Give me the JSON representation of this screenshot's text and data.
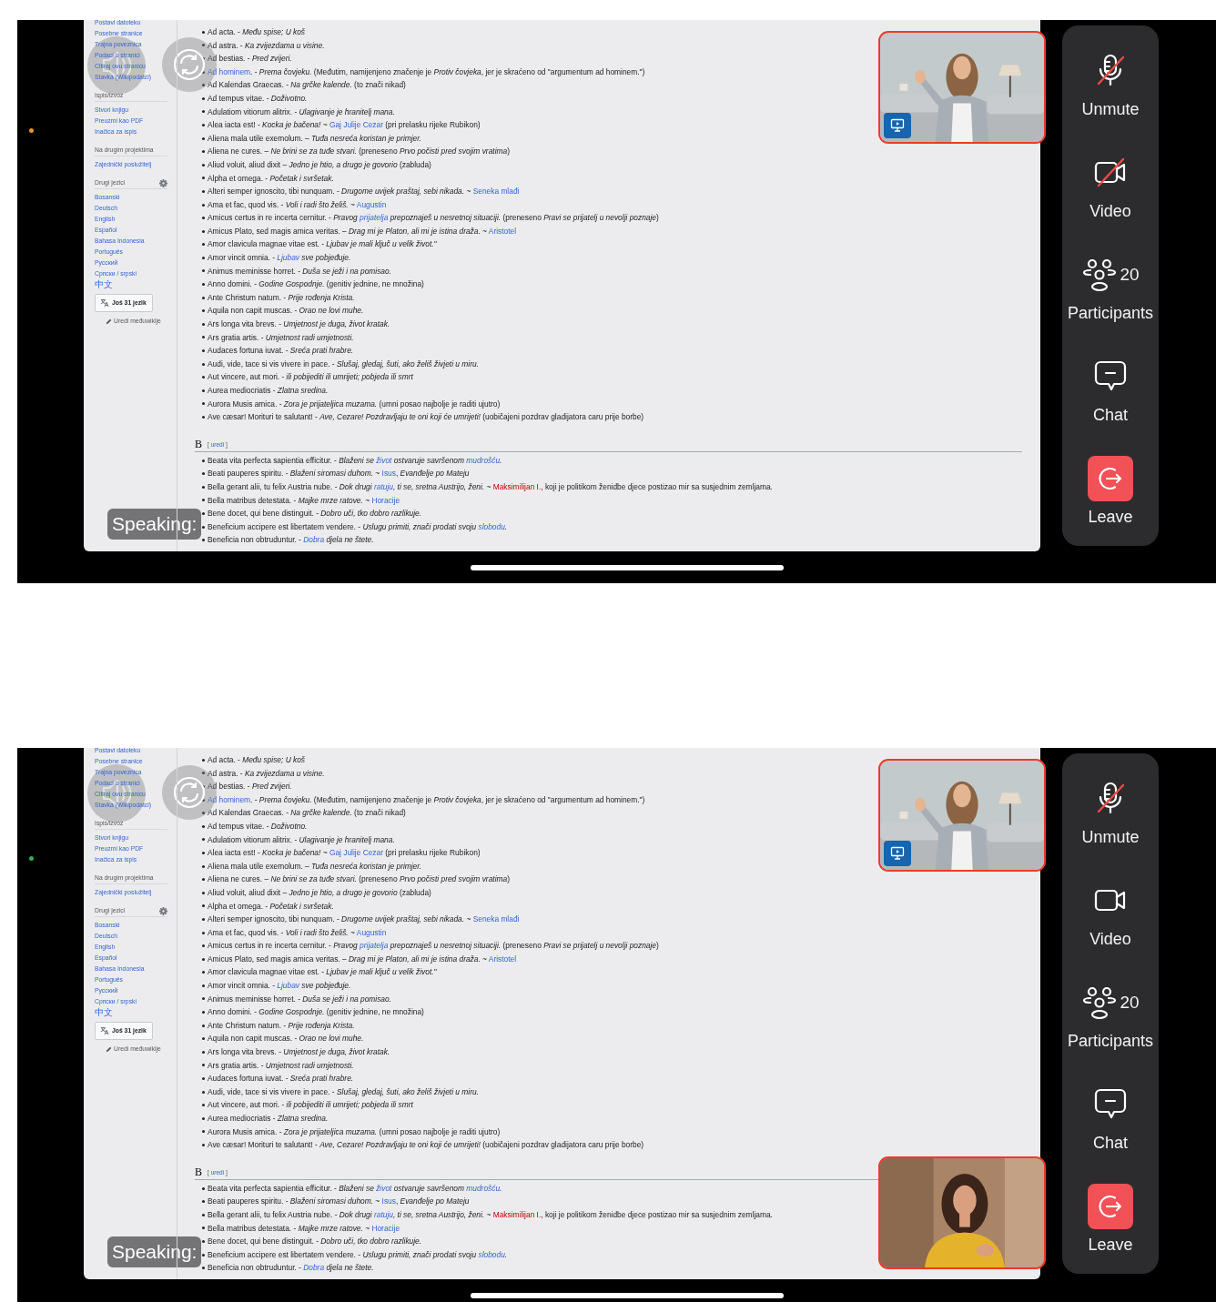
{
  "screens": [
    {
      "status_dot": {
        "color": "#f0901e"
      },
      "shared_page": {
        "sidebar": {
          "groups": [
            {
              "settings_icon": false,
              "links": [
                "Postavi datoteku",
                "Posebne stranice",
                "Trajna poveznica",
                "Podaci o stranici",
                "Citiraj ovu stranicu",
                "Stavka (Wikipodatci)"
              ]
            },
            {
              "heading": "Ispis/izvoz",
              "settings_icon": false,
              "links": [
                "Stvori knjigu",
                "Preuzmi kao PDF",
                "Inačica za ispis"
              ]
            },
            {
              "heading": "Na drugim projektima",
              "settings_icon": false,
              "links": [
                "Zajednički poslužitelj"
              ]
            },
            {
              "heading": "Drugi jezici",
              "settings_icon": true,
              "links": [
                "Bosanski",
                "Deutsch",
                "English",
                "Español",
                "Bahasa Indonesia",
                "Português",
                "Русский",
                "Српски / srpski",
                "中文"
              ]
            }
          ],
          "more_languages_button": "Još 31 jezik",
          "edit_interlanguage_link": "Uredi međuwikije"
        },
        "entries_a": [
          [
            {
              "text": "Ad acta. - *Među spise; U koš*",
              "kind": "text"
            }
          ],
          [
            {
              "text": "Ad astra. - *Ka zvijezdama u visine.*",
              "kind": "text"
            }
          ],
          [
            {
              "text": "Ad bestias. - *Pred zvijeri.*",
              "kind": "text"
            }
          ],
          [
            {
              "text": "Ad hominem",
              "kind": "link"
            },
            {
              "text": ". - *Prema čovjeku.* (Međutim, namijenjeno značenje je *Protiv čovjeka*, jer je skraćeno od \"argumentum ad hominem.\")",
              "kind": "text"
            }
          ],
          [
            {
              "text": "Ad Kalendas Graecas. - *Na grčke kalende.* (to znači nikad)",
              "kind": "text"
            }
          ],
          [
            {
              "text": "Ad tempus vitae. - *Doživotno.*",
              "kind": "text"
            }
          ],
          [
            {
              "text": "Adulatiom vitiorum alitrix. - *Ulagivanje je hranitelj mana.*",
              "kind": "text"
            }
          ],
          [
            {
              "text": "Alea iacta est! - *Kocka je bačena!* ~ ",
              "kind": "text"
            },
            {
              "text": "Gaj Julije Cezar",
              "kind": "link"
            },
            {
              "text": " (pri prelasku rijeke Rubikon)",
              "kind": "text"
            }
          ],
          [
            {
              "text": "Aliena mala utile exemolum. – *Tuđa nesreća koristan je primjer.*",
              "kind": "text"
            }
          ],
          [
            {
              "text": "Aliena ne cures. – *Ne brini se za tuđe stvari.* (preneseno *Prvo počisti pred svojim vratima*)",
              "kind": "text"
            }
          ],
          [
            {
              "text": "Aliud voluit, aliud dixit – *Jedno je htio, a drugo je govorio* (zabluda)",
              "kind": "text"
            }
          ],
          [
            {
              "text": "Alpha et omega. - *Početak i svršetak.*",
              "kind": "text"
            }
          ],
          [
            {
              "text": "Alteri semper ignoscito, tibi nunquam. - *Drugome uvijek praštaj, sebi nikada.* ~ ",
              "kind": "text"
            },
            {
              "text": "Seneka mlađi",
              "kind": "link"
            }
          ],
          [
            {
              "text": "Ama et fac, quod vis. - *Voli i radi što želiš.* ~ ",
              "kind": "text"
            },
            {
              "text": "Augustin",
              "kind": "link"
            }
          ],
          [
            {
              "text": "Amicus certus in re incerta cernitur. - *Pravog* ",
              "kind": "text"
            },
            {
              "text": "prijatelja",
              "kind": "emlink"
            },
            {
              "text": " *prepoznaješ u nesretnoj situaciji.* (preneseno *Pravi se prijatelj u nevolji poznaje*)",
              "kind": "text"
            }
          ],
          [
            {
              "text": "Amicus Plato, sed magis amica veritas. – *Drag mi je Platon, ali mi je istina draža.* ~ ",
              "kind": "text"
            },
            {
              "text": "Aristotel",
              "kind": "link"
            }
          ],
          [
            {
              "text": "Amor clavicula magnae vitae est. - *Ljubav je mali ključ u velik život.\"*",
              "kind": "text"
            }
          ],
          [
            {
              "text": "Amor vincit omnia. - ",
              "kind": "text"
            },
            {
              "text": "Ljubav",
              "kind": "emlink"
            },
            {
              "text": " *sve pobjeđuje.*",
              "kind": "text"
            }
          ],
          [
            {
              "text": "Animus meminisse horret. - *Duša se ježi i na pomisao.*",
              "kind": "text"
            }
          ],
          [
            {
              "text": "Anno domini. - *Godine Gospodnje.* (genitiv jednine, ne množina)",
              "kind": "text"
            }
          ],
          [
            {
              "text": "Ante Christum natum. - *Prije rođenja Krista.*",
              "kind": "text"
            }
          ],
          [
            {
              "text": "Aquila non capit muscas. - *Orao ne lovi muhe.*",
              "kind": "text"
            }
          ],
          [
            {
              "text": "Ars longa vita brevs. - *Umjetnost je duga, život kratak.*",
              "kind": "text"
            }
          ],
          [
            {
              "text": "Ars gratia artis. - *Umjetnost radi umjetnosti.*",
              "kind": "text"
            }
          ],
          [
            {
              "text": "Audaces fortuna iuvat. - *Sreća prati hrabre.*",
              "kind": "text"
            }
          ],
          [
            {
              "text": "Audi, vide, tace si vis vivere in pace. - *Slušaj, gledaj, šuti, ako želiš živjeti u miru.*",
              "kind": "text"
            }
          ],
          [
            {
              "text": "Aut vincere, aut mori. - *ili pobijediti ili umrijeti; pobjeda ili smrt*",
              "kind": "text"
            }
          ],
          [
            {
              "text": "Aurea mediocriatis - *Zlatna sredina.*",
              "kind": "text"
            }
          ],
          [
            {
              "text": "Aurora Musis amica. - *Zora je prijateljica muzama.* (umni posao najbolje je raditi ujutro)",
              "kind": "text"
            }
          ],
          [
            {
              "text": "Ave cæsar! Morituri te salutant! - *Ave, Cezare! Pozdravljaju te oni koji će umrijeti!* (uobičajeni pozdrav gladijatora caru prije borbe)",
              "kind": "text"
            }
          ]
        ],
        "section": {
          "heading": "B",
          "edit_open": "[",
          "edit_link": "uredi",
          "edit_close": "]"
        },
        "entries_b": [
          [
            {
              "text": "Beata vita perfecta sapientia efficitur. - *Blaženi se* ",
              "kind": "text"
            },
            {
              "text": "život",
              "kind": "emlink"
            },
            {
              "text": " *ostvaruje savršenom* ",
              "kind": "text"
            },
            {
              "text": "mudrošću",
              "kind": "emlink"
            },
            {
              "text": "*.*",
              "kind": "text"
            }
          ],
          [
            {
              "text": "Beati pauperes spiritu. - *Blaženi siromasi duhom.* ~ ",
              "kind": "text"
            },
            {
              "text": "Isus",
              "kind": "link"
            },
            {
              "text": ", *Evanđelje po Mateju*",
              "kind": "text"
            }
          ],
          [
            {
              "text": "Bella gerant alii, tu felix Austria nube. - *Dok drugi* ",
              "kind": "text"
            },
            {
              "text": "ratuju",
              "kind": "emlink"
            },
            {
              "text": "*, ti se, sretna Austrijo, ženi.* ~ ",
              "kind": "text"
            },
            {
              "text": "Maksimilijan I.",
              "kind": "redlink"
            },
            {
              "text": ", koji je politikom ženidbe djece postizao mir sa susjednim zemljama.",
              "kind": "text"
            }
          ],
          [
            {
              "text": "Bella matribus detestata. - *Majke mrze ratove.* ~ ",
              "kind": "text"
            },
            {
              "text": "Horacije",
              "kind": "link"
            }
          ],
          [
            {
              "text": "Bene docet, qui bene distinguit. - *Dobro uči, tko dobro razlikuje.*",
              "kind": "text"
            }
          ],
          [
            {
              "text": "Beneficium accipere est libertatem vendere. - *Uslugu primiti, znači prodati svoju* ",
              "kind": "text"
            },
            {
              "text": "slobodu",
              "kind": "emlink"
            },
            {
              "text": "*.*",
              "kind": "text"
            }
          ],
          [
            {
              "text": "Beneficia non obtruduntur. - ",
              "kind": "text"
            },
            {
              "text": "Dobra",
              "kind": "emlink"
            },
            {
              "text": " *djela ne štete.*",
              "kind": "text"
            }
          ]
        ]
      },
      "speaking_label": "Speaking:",
      "videos": [
        {
          "kind": "picture",
          "screen_sharing": true
        }
      ],
      "controls": [
        {
          "kind": "mic",
          "label": "Unmute",
          "off": true
        },
        {
          "kind": "camera",
          "label": "Video",
          "off": true
        },
        {
          "kind": "participants",
          "label": "Participants",
          "count": "20"
        },
        {
          "kind": "chat",
          "label": "Chat"
        },
        {
          "kind": "leave",
          "label": "Leave"
        }
      ]
    },
    {
      "status_dot": {
        "color": "#2db34a"
      },
      "shared_page": {
        "sidebar": {
          "groups": [
            {
              "settings_icon": false,
              "links": [
                "Postavi datoteku",
                "Posebne stranice",
                "Trajna poveznica",
                "Podaci o stranici",
                "Citiraj ovu stranicu",
                "Stavka (Wikipodatci)"
              ]
            },
            {
              "heading": "Ispis/izvoz",
              "settings_icon": false,
              "links": [
                "Stvori knjigu",
                "Preuzmi kao PDF",
                "Inačica za ispis"
              ]
            },
            {
              "heading": "Na drugim projektima",
              "settings_icon": false,
              "links": [
                "Zajednički poslužitelj"
              ]
            },
            {
              "heading": "Drugi jezici",
              "settings_icon": true,
              "links": [
                "Bosanski",
                "Deutsch",
                "English",
                "Español",
                "Bahasa Indonesia",
                "Português",
                "Русский",
                "Српски / srpski",
                "中文"
              ]
            }
          ],
          "more_languages_button": "Još 31 jezik",
          "edit_interlanguage_link": "Uredi međuwikije"
        },
        "entries_a": [
          [
            {
              "text": "Ad acta. - *Među spise; U koš*",
              "kind": "text"
            }
          ],
          [
            {
              "text": "Ad astra. - *Ka zvijezdama u visine.*",
              "kind": "text"
            }
          ],
          [
            {
              "text": "Ad bestias. - *Pred zvijeri.*",
              "kind": "text"
            }
          ],
          [
            {
              "text": "Ad hominem",
              "kind": "link"
            },
            {
              "text": ". - *Prema čovjeku.* (Međutim, namijenjeno značenje je *Protiv čovjeka*, jer je skraćeno od \"argumentum ad hominem.\")",
              "kind": "text"
            }
          ],
          [
            {
              "text": "Ad Kalendas Graecas. - *Na grčke kalende.* (to znači nikad)",
              "kind": "text"
            }
          ],
          [
            {
              "text": "Ad tempus vitae. - *Doživotno.*",
              "kind": "text"
            }
          ],
          [
            {
              "text": "Adulatiom vitiorum alitrix. - *Ulagivanje je hranitelj mana.*",
              "kind": "text"
            }
          ],
          [
            {
              "text": "Alea iacta est! - *Kocka je bačena!* ~ ",
              "kind": "text"
            },
            {
              "text": "Gaj Julije Cezar",
              "kind": "link"
            },
            {
              "text": " (pri prelasku rijeke Rubikon)",
              "kind": "text"
            }
          ],
          [
            {
              "text": "Aliena mala utile exemolum. – *Tuđa nesreća koristan je primjer.*",
              "kind": "text"
            }
          ],
          [
            {
              "text": "Aliena ne cures. – *Ne brini se za tuđe stvari.* (preneseno *Prvo počisti pred svojim vratima*)",
              "kind": "text"
            }
          ],
          [
            {
              "text": "Aliud voluit, aliud dixit – *Jedno je htio, a drugo je govorio* (zabluda)",
              "kind": "text"
            }
          ],
          [
            {
              "text": "Alpha et omega. - *Početak i svršetak.*",
              "kind": "text"
            }
          ],
          [
            {
              "text": "Alteri semper ignoscito, tibi nunquam. - *Drugome uvijek praštaj, sebi nikada.* ~ ",
              "kind": "text"
            },
            {
              "text": "Seneka mlađi",
              "kind": "link"
            }
          ],
          [
            {
              "text": "Ama et fac, quod vis. - *Voli i radi što želiš.* ~ ",
              "kind": "text"
            },
            {
              "text": "Augustin",
              "kind": "link"
            }
          ],
          [
            {
              "text": "Amicus certus in re incerta cernitur. - *Pravog* ",
              "kind": "text"
            },
            {
              "text": "prijatelja",
              "kind": "emlink"
            },
            {
              "text": " *prepoznaješ u nesretnoj situaciji.* (preneseno *Pravi se prijatelj u nevolji poznaje*)",
              "kind": "text"
            }
          ],
          [
            {
              "text": "Amicus Plato, sed magis amica veritas. – *Drag mi je Platon, ali mi je istina draža.* ~ ",
              "kind": "text"
            },
            {
              "text": "Aristotel",
              "kind": "link"
            }
          ],
          [
            {
              "text": "Amor clavicula magnae vitae est. - *Ljubav je mali ključ u velik život.\"*",
              "kind": "text"
            }
          ],
          [
            {
              "text": "Amor vincit omnia. - ",
              "kind": "text"
            },
            {
              "text": "Ljubav",
              "kind": "emlink"
            },
            {
              "text": " *sve pobjeđuje.*",
              "kind": "text"
            }
          ],
          [
            {
              "text": "Animus meminisse horret. - *Duša se ježi i na pomisao.*",
              "kind": "text"
            }
          ],
          [
            {
              "text": "Anno domini. - *Godine Gospodnje.* (genitiv jednine, ne množina)",
              "kind": "text"
            }
          ],
          [
            {
              "text": "Ante Christum natum. - *Prije rođenja Krista.*",
              "kind": "text"
            }
          ],
          [
            {
              "text": "Aquila non capit muscas. - *Orao ne lovi muhe.*",
              "kind": "text"
            }
          ],
          [
            {
              "text": "Ars longa vita brevs. - *Umjetnost je duga, život kratak.*",
              "kind": "text"
            }
          ],
          [
            {
              "text": "Ars gratia artis. - *Umjetnost radi umjetnosti.*",
              "kind": "text"
            }
          ],
          [
            {
              "text": "Audaces fortuna iuvat. - *Sreća prati hrabre.*",
              "kind": "text"
            }
          ],
          [
            {
              "text": "Audi, vide, tace si vis vivere in pace. - *Slušaj, gledaj, šuti, ako želiš živjeti u miru.*",
              "kind": "text"
            }
          ],
          [
            {
              "text": "Aut vincere, aut mori. - *ili pobijediti ili umrijeti; pobjeda ili smrt*",
              "kind": "text"
            }
          ],
          [
            {
              "text": "Aurea mediocriatis - *Zlatna sredina.*",
              "kind": "text"
            }
          ],
          [
            {
              "text": "Aurora Musis amica. - *Zora je prijateljica muzama.* (umni posao najbolje je raditi ujutro)",
              "kind": "text"
            }
          ],
          [
            {
              "text": "Ave cæsar! Morituri te salutant! - *Ave, Cezare! Pozdravljaju te oni koji će umrijeti!* (uobičajeni pozdrav gladijatora caru prije borbe)",
              "kind": "text"
            }
          ]
        ],
        "section": {
          "heading": "B",
          "edit_open": "[",
          "edit_link": "uredi",
          "edit_close": "]"
        },
        "entries_b": [
          [
            {
              "text": "Beata vita perfecta sapientia efficitur. - *Blaženi se* ",
              "kind": "text"
            },
            {
              "text": "život",
              "kind": "emlink"
            },
            {
              "text": " *ostvaruje savršenom* ",
              "kind": "text"
            },
            {
              "text": "mudrošću",
              "kind": "emlink"
            },
            {
              "text": "*.*",
              "kind": "text"
            }
          ],
          [
            {
              "text": "Beati pauperes spiritu. - *Blaženi siromasi duhom.* ~ ",
              "kind": "text"
            },
            {
              "text": "Isus",
              "kind": "link"
            },
            {
              "text": ", *Evanđelje po Mateju*",
              "kind": "text"
            }
          ],
          [
            {
              "text": "Bella gerant alii, tu felix Austria nube. - *Dok drugi* ",
              "kind": "text"
            },
            {
              "text": "ratuju",
              "kind": "emlink"
            },
            {
              "text": "*, ti se, sretna Austrijo, ženi.* ~ ",
              "kind": "text"
            },
            {
              "text": "Maksimilijan I.",
              "kind": "redlink"
            },
            {
              "text": ", koji je politikom ženidbe djece postizao mir sa susjednim zemljama.",
              "kind": "text"
            }
          ],
          [
            {
              "text": "Bella matribus detestata. - *Majke mrze ratove.* ~ ",
              "kind": "text"
            },
            {
              "text": "Horacije",
              "kind": "link"
            }
          ],
          [
            {
              "text": "Bene docet, qui bene distinguit. - *Dobro uči, tko dobro razlikuje.*",
              "kind": "text"
            }
          ],
          [
            {
              "text": "Beneficium accipere est libertatem vendere. - *Uslugu primiti, znači prodati svoju* ",
              "kind": "text"
            },
            {
              "text": "slobodu",
              "kind": "emlink"
            },
            {
              "text": "*.*",
              "kind": "text"
            }
          ],
          [
            {
              "text": "Beneficia non obtruduntur. - ",
              "kind": "text"
            },
            {
              "text": "Dobra",
              "kind": "emlink"
            },
            {
              "text": " *djela ne štete.*",
              "kind": "text"
            }
          ]
        ]
      },
      "speaking_label": "Speaking:",
      "videos": [
        {
          "kind": "picture",
          "screen_sharing": true
        },
        {
          "kind": "picture",
          "screen_sharing": false
        }
      ],
      "controls": [
        {
          "kind": "mic",
          "label": "Unmute",
          "off": true
        },
        {
          "kind": "camera",
          "label": "Video",
          "off": false
        },
        {
          "kind": "participants",
          "label": "Participants",
          "count": "20"
        },
        {
          "kind": "chat",
          "label": "Chat"
        },
        {
          "kind": "leave",
          "label": "Leave"
        }
      ]
    }
  ]
}
